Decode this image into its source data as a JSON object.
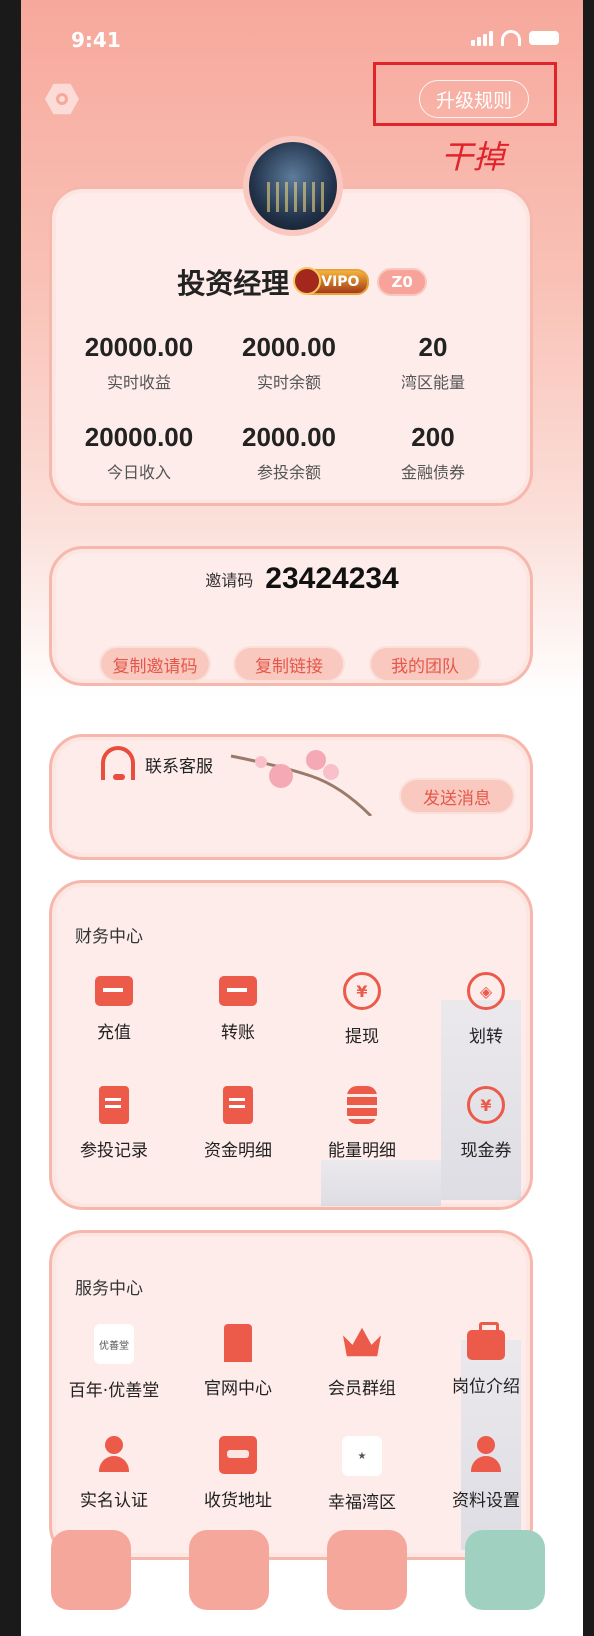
{
  "status_bar": {
    "time": "9:41"
  },
  "header": {
    "upgrade_button": "升级规则",
    "annotation_note": "干掉",
    "annotation_color": "#e0242b"
  },
  "profile": {
    "name": "投资经理",
    "vip_badge": "VIPO",
    "level_badge": "Z0",
    "stats": [
      {
        "value": "20000.00",
        "label": "实时收益"
      },
      {
        "value": "2000.00",
        "label": "实时余额"
      },
      {
        "value": "20",
        "label": "湾区能量"
      },
      {
        "value": "20000.00",
        "label": "今日收入"
      },
      {
        "value": "2000.00",
        "label": "参投余额"
      },
      {
        "value": "200",
        "label": "金融债券"
      }
    ]
  },
  "invite": {
    "label": "邀请码",
    "code": "23424234",
    "buttons": [
      "复制邀请码",
      "复制链接",
      "我的团队"
    ]
  },
  "support": {
    "label": "联系客服",
    "send_button": "发送消息"
  },
  "finance_center": {
    "title": "财务中心",
    "items": [
      {
        "label": "充值",
        "icon": "card-icon"
      },
      {
        "label": "转账",
        "icon": "transfer-icon"
      },
      {
        "label": "提现",
        "icon": "withdraw-icon"
      },
      {
        "label": "划转",
        "icon": "exchange-icon"
      },
      {
        "label": "参投记录",
        "icon": "record-icon"
      },
      {
        "label": "资金明细",
        "icon": "fund-detail-icon"
      },
      {
        "label": "能量明细",
        "icon": "energy-detail-icon"
      },
      {
        "label": "现金券",
        "icon": "coupon-icon"
      }
    ]
  },
  "service_center": {
    "title": "服务中心",
    "items": [
      {
        "label": "百年·优善堂",
        "icon": "youshantang-logo",
        "logo_text": "优善堂"
      },
      {
        "label": "官网中心",
        "icon": "building-icon"
      },
      {
        "label": "会员群组",
        "icon": "crown-icon"
      },
      {
        "label": "岗位介绍",
        "icon": "briefcase-icon"
      },
      {
        "label": "实名认证",
        "icon": "verified-user-icon"
      },
      {
        "label": "收货地址",
        "icon": "inbox-icon"
      },
      {
        "label": "幸福湾区",
        "icon": "xingfu-bay-logo"
      },
      {
        "label": "资料设置",
        "icon": "profile-settings-icon"
      }
    ]
  },
  "colors": {
    "accent": "#ec5a4a",
    "hero_top": "#f7a89c",
    "card_bg": "#fdecea"
  }
}
